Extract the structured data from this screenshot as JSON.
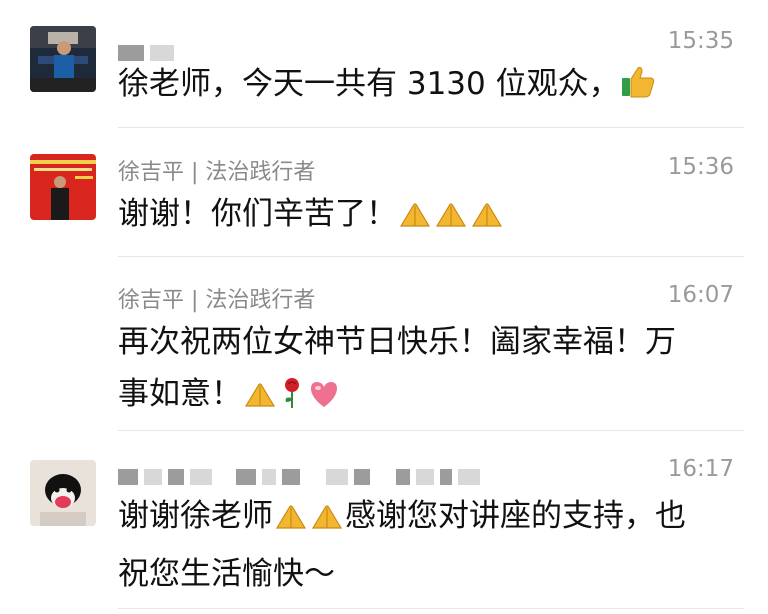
{
  "messages": [
    {
      "sender": "",
      "time": "15:35",
      "text": "徐老师，今天一共有 3130 位观众，",
      "emojis": [
        "thumbs-up"
      ]
    },
    {
      "sender": "徐吉平 | 法治践行者",
      "time": "15:36",
      "text": "谢谢！你们辛苦了！",
      "emojis": [
        "folded-hands",
        "folded-hands",
        "folded-hands"
      ]
    },
    {
      "sender": "徐吉平 | 法治践行者",
      "time": "16:07",
      "line1": "再次祝两位女神节日快乐！阖家幸福！万",
      "line2": "事如意！",
      "emojis": [
        "folded-hands",
        "rose",
        "heart"
      ]
    },
    {
      "sender": "",
      "time": "16:17",
      "text_a": "谢谢徐老师",
      "text_b": "感谢您对讲座的支持，也",
      "line2": "祝您生活愉快～",
      "emojis": [
        "folded-hands",
        "folded-hands"
      ]
    }
  ],
  "colors": {
    "time": "#9a9a9a",
    "sender": "#8a8a8a",
    "divider": "#e6e6e6",
    "redbanner": "#d8261f",
    "gold": "#f2b631"
  }
}
